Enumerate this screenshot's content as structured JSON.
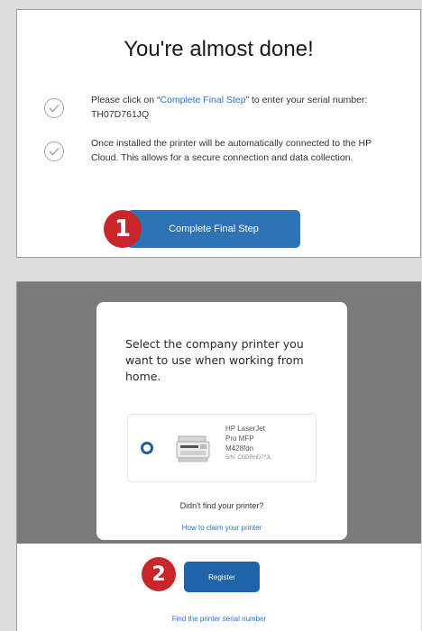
{
  "panel1": {
    "title": "You're almost done!",
    "step1_prefix": "Please click on “",
    "step1_link": "Complete Final Step",
    "step1_suffix": "” to enter your serial number: TH07D761JQ",
    "step2_text": "Once installed the printer will be automatically connected to the HP Cloud. This allows for a secure connection and data collection.",
    "button_label": "Complete Final Step",
    "badge": "1",
    "icons": [
      "check-circle-icon",
      "check-circle-icon"
    ]
  },
  "panel2": {
    "modal_title": "Select the company printer you want to use when working from home.",
    "printer": {
      "name_line1": "HP LaserJet",
      "name_line2": "Pro MFP",
      "name_line3": "M428fdn",
      "serial": "S/N: CNDRHD7*JL",
      "icon": "printer-icon"
    },
    "not_found_text": "Didn't find your printer?",
    "claim_link": "How to claim your printer",
    "register_label": "Register",
    "badge": "2",
    "serial_link": "Find the printer serial number"
  },
  "colors": {
    "button_blue": "#2e73b6",
    "link_blue": "#2e71c4",
    "badge_red": "#c8262b",
    "overlay_gray": "#7a7a7a"
  }
}
